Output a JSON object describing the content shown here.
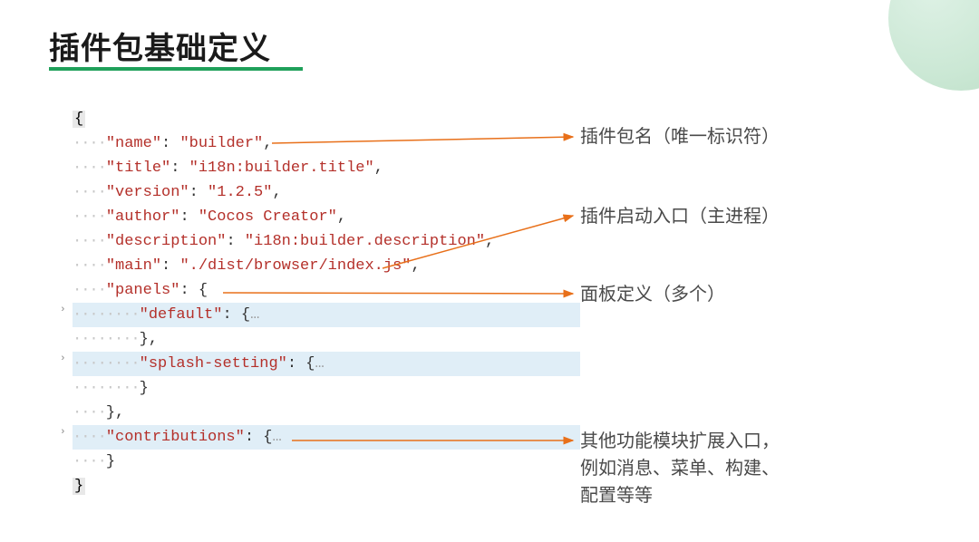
{
  "title": "插件包基础定义",
  "code": {
    "open_brace": "{",
    "close_brace": "}",
    "name_key": "\"name\"",
    "name_val": "\"builder\"",
    "title_key": "\"title\"",
    "title_val": "\"i18n:builder.title\"",
    "version_key": "\"version\"",
    "version_val": "\"1.2.5\"",
    "author_key": "\"author\"",
    "author_val": "\"Cocos Creator\"",
    "description_key": "\"description\"",
    "description_val": "\"i18n:builder.description\"",
    "main_key": "\"main\"",
    "main_val": "\"./dist/browser/index.js\"",
    "panels_key": "\"panels\"",
    "default_key": "\"default\"",
    "splash_key": "\"splash-setting\"",
    "contributions_key": "\"contributions\"",
    "ellipsis": "…"
  },
  "annotations": {
    "a1": "插件包名（唯一标识符）",
    "a2": "插件启动入口（主进程）",
    "a3": "面板定义（多个）",
    "a4": "其他功能模块扩展入口，\n例如消息、菜单、构建、\n配置等等"
  }
}
